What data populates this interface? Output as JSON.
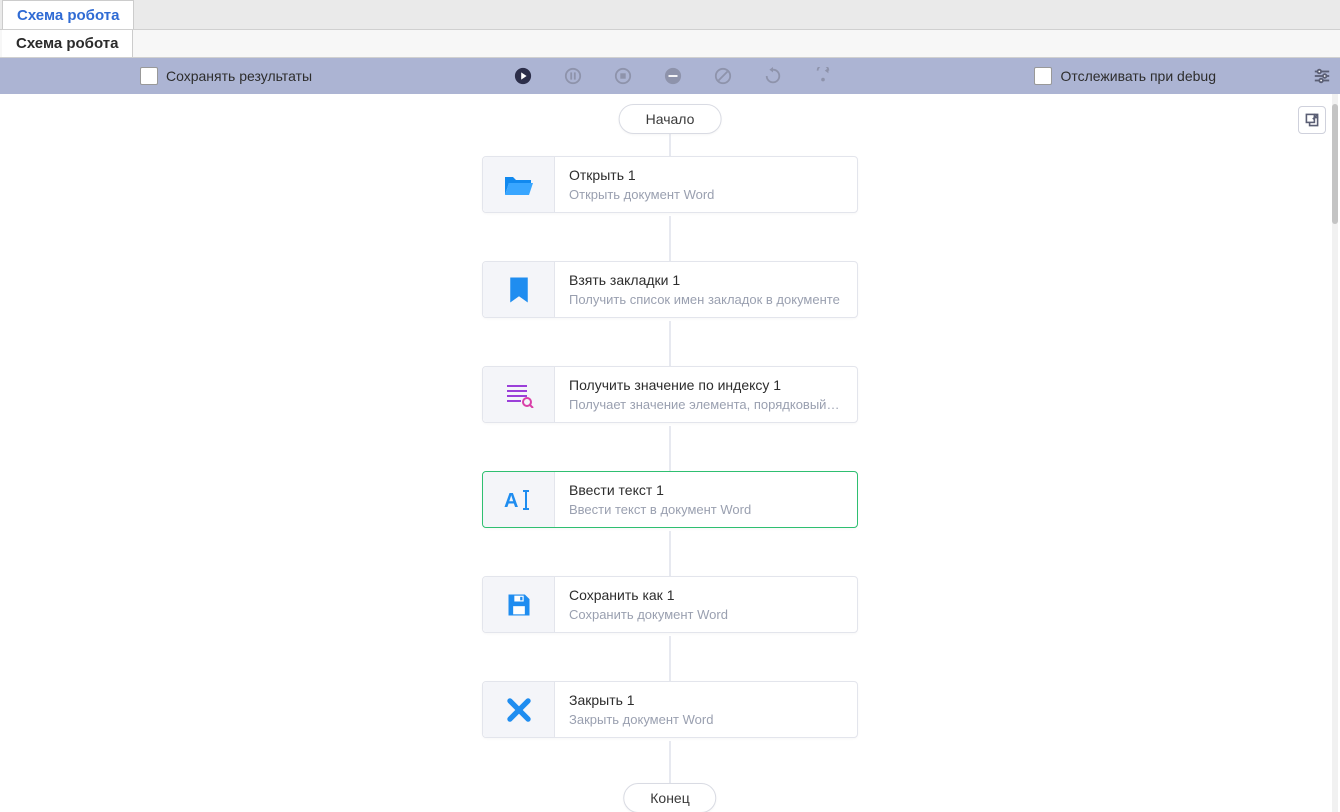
{
  "tabs": {
    "main": "Схема робота",
    "sub": "Схема робота"
  },
  "toolbar": {
    "save_results_label": "Сохранять результаты",
    "debug_label": "Отслеживать при debug"
  },
  "flow": {
    "start_label": "Начало",
    "end_label": "Конец",
    "nodes": [
      {
        "title": "Открыть  1",
        "desc": "Открыть документ Word",
        "icon": "folder-open",
        "selected": false
      },
      {
        "title": "Взять закладки  1",
        "desc": "Получить список имен закладок в документе",
        "icon": "bookmark",
        "selected": false
      },
      {
        "title": "Получить значение по индексу  1",
        "desc": "Получает значение элемента, порядковый но…",
        "icon": "index-list",
        "selected": false
      },
      {
        "title": "Ввести текст  1",
        "desc": "Ввести текст в документ Word",
        "icon": "text-cursor",
        "selected": true
      },
      {
        "title": "Сохранить как  1",
        "desc": "Сохранить документ Word",
        "icon": "save",
        "selected": false
      },
      {
        "title": "Закрыть  1",
        "desc": "Закрыть документ Word",
        "icon": "close-x",
        "selected": false
      }
    ]
  }
}
